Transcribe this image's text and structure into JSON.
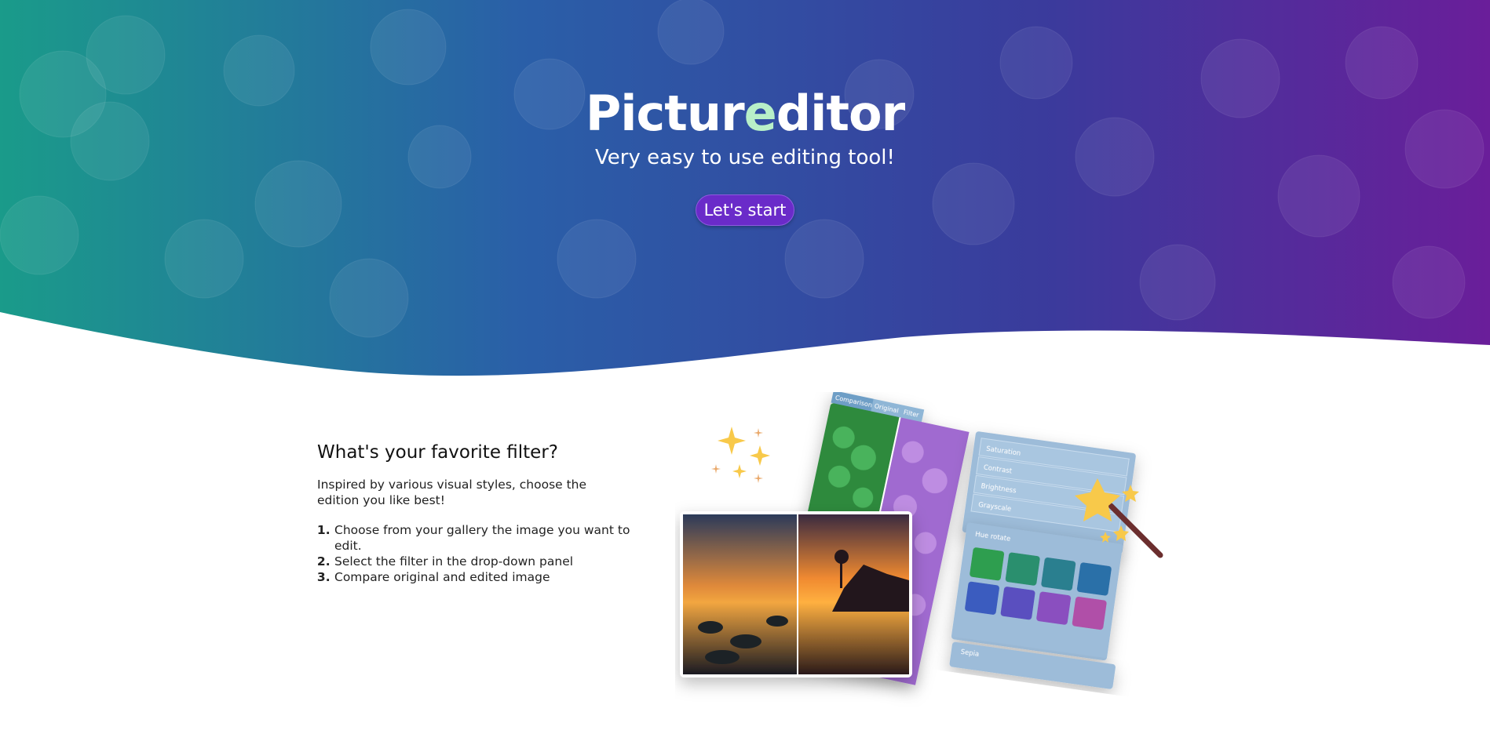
{
  "hero": {
    "title_part1": "Pictur",
    "title_accent": "e",
    "title_part2": "ditor",
    "subtitle": "Very easy to use editing tool!",
    "start_button": "Let's start",
    "gradient_colors": [
      "#1a9b8a",
      "#2a5fa8",
      "#3a3b9c",
      "#6a1e9a"
    ]
  },
  "content": {
    "heading": "What's your favorite filter?",
    "intro": "Inspired by various visual styles, choose the edition you like best!",
    "steps": [
      "Choose from your gallery the image you want to edit.",
      "Select the filter in the drop-down panel",
      "Compare original and edited image"
    ]
  },
  "illustration": {
    "tabs": [
      "Comparison",
      "Original",
      "Filter"
    ],
    "panel_items": [
      "Saturation",
      "Contrast",
      "Brightness",
      "Grayscale"
    ],
    "hue_panel_label": "Hue rotate",
    "sepia_label": "Sepia",
    "hue_swatch_colors": [
      "#2f9e4f",
      "#2a8f6e",
      "#2a7f8f",
      "#2a6fa8",
      "#3a5cbf",
      "#5a4fbf",
      "#8a4fbf",
      "#b04fa8"
    ]
  }
}
